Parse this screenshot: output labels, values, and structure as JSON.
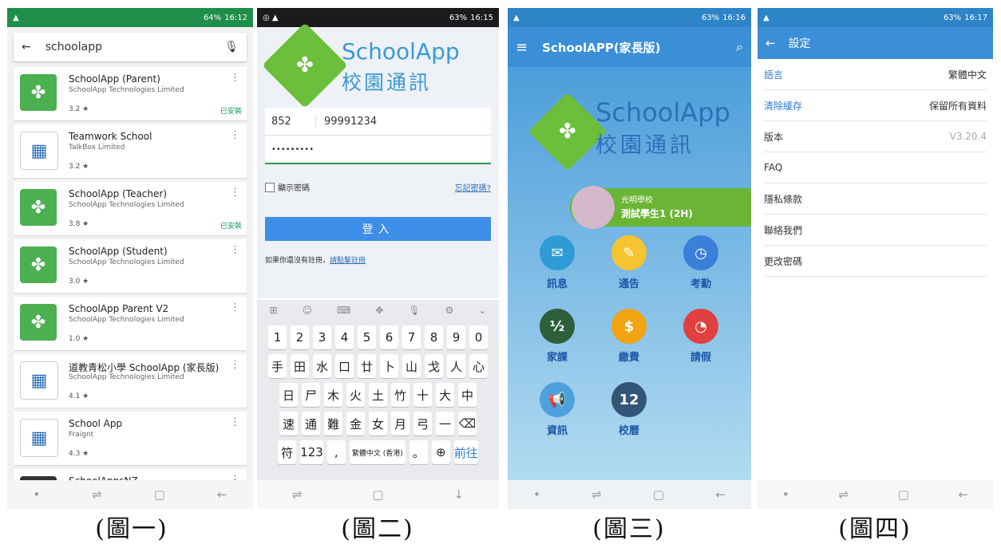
{
  "phone1": {
    "status_time": "16:12",
    "status_battery": "64%",
    "search_query": "schoolapp",
    "apps": [
      {
        "name": "SchoolApp (Parent)",
        "developer": "SchoolApp Technologies Limited",
        "rating": "3.2 ★",
        "installed": "已安裝",
        "icon_color": "#4caf50",
        "icon_label": "Parent"
      },
      {
        "name": "Teamwork School",
        "developer": "TalkBox Limited",
        "rating": "3.2 ★",
        "installed": "",
        "icon_color": "#ffffff",
        "icon_label": ""
      },
      {
        "name": "SchoolApp (Teacher)",
        "developer": "SchoolApp Technologies Limited",
        "rating": "3.8 ★",
        "installed": "已安裝",
        "icon_color": "#4caf50",
        "icon_label": "Teacher"
      },
      {
        "name": "SchoolApp (Student)",
        "developer": "SchoolApp Technologies Limited",
        "rating": "3.0 ★",
        "installed": "",
        "icon_color": "#4caf50",
        "icon_label": "Student"
      },
      {
        "name": "SchoolApp Parent V2",
        "developer": "SchoolApp Technologies Limited",
        "rating": "1.0 ★",
        "installed": "",
        "icon_color": "#4caf50",
        "icon_label": "Parent"
      },
      {
        "name": "道教青松小學 SchoolApp (家長版)",
        "developer": "SchoolApp Technologies Limited",
        "rating": "4.1 ★",
        "installed": "",
        "icon_color": "#ffffff",
        "icon_label": ""
      },
      {
        "name": "School App",
        "developer": "Fraignt",
        "rating": "4.3 ★",
        "installed": "",
        "icon_color": "#ffffff",
        "icon_label": ""
      },
      {
        "name": "SchoolAppsNZ",
        "developer": "",
        "rating": "",
        "installed": "",
        "icon_color": "#333333",
        "icon_label": ""
      }
    ],
    "caption": "(圖一)"
  },
  "phone2": {
    "status_time": "16:15",
    "status_battery": "63%",
    "logo_en": "SchoolApp",
    "logo_zh": "校園通訊",
    "country_code": "852",
    "phone_number": "99991234",
    "password": "•••••••••",
    "show_password": "顯示密碼",
    "forgot_password": "忘記密碼?",
    "login_button": "登入",
    "register_prompt": "如果你還沒有註冊，",
    "register_link": "請點擊註冊",
    "kb_row1": [
      "1",
      "2",
      "3",
      "4",
      "5",
      "6",
      "7",
      "8",
      "9",
      "0"
    ],
    "kb_row2": [
      "手",
      "田",
      "水",
      "口",
      "廿",
      "卜",
      "山",
      "戈",
      "人",
      "心"
    ],
    "kb_row3": [
      "日",
      "尸",
      "木",
      "火",
      "土",
      "竹",
      "十",
      "大",
      "中"
    ],
    "kb_row4": [
      "速",
      "通",
      "難",
      "金",
      "女",
      "月",
      "弓",
      "一",
      "⌫"
    ],
    "kb_row5": [
      "符",
      "123",
      ",",
      "繁體中文 (香港)",
      "。",
      "⊕",
      "前往"
    ],
    "caption": "(圖二)"
  },
  "phone3": {
    "status_time": "16:16",
    "status_battery": "63%",
    "app_title": "SchoolAPP(家長版)",
    "logo_en": "SchoolApp",
    "logo_zh": "校園通訊",
    "school_name": "光明學校",
    "student_name": "測試學生1 (2H)",
    "menu": [
      {
        "label": "訊息",
        "icon": "chat-icon",
        "color": "#2e9bd6",
        "glyph": "✉"
      },
      {
        "label": "通告",
        "icon": "notice-icon",
        "color": "#f5c431",
        "glyph": "✎"
      },
      {
        "label": "考勤",
        "icon": "clock-icon",
        "color": "#3a7fd8",
        "glyph": "◷"
      },
      {
        "label": "家課",
        "icon": "homework-icon",
        "color": "#2d5f3a",
        "glyph": "½"
      },
      {
        "label": "繳費",
        "icon": "payment-icon",
        "color": "#f2a312",
        "glyph": "$"
      },
      {
        "label": "請假",
        "icon": "leave-icon",
        "color": "#e04040",
        "glyph": "◔"
      },
      {
        "label": "資訊",
        "icon": "megaphone-icon",
        "color": "#4ea0dd",
        "glyph": "📢"
      },
      {
        "label": "校曆",
        "icon": "calendar-icon",
        "color": "#335577",
        "glyph": "12"
      }
    ],
    "caption": "(圖三)"
  },
  "phone4": {
    "status_time": "16:17",
    "status_battery": "63%",
    "title": "設定",
    "rows": [
      {
        "label": "語言",
        "value": "繁體中文",
        "blue": true,
        "grey": false
      },
      {
        "label": "清除緩存",
        "value": "保留所有資料",
        "blue": true,
        "grey": false
      },
      {
        "label": "版本",
        "value": "V3.20.4",
        "blue": false,
        "grey": true
      },
      {
        "label": "FAQ",
        "value": "",
        "blue": false,
        "grey": false
      },
      {
        "label": "隱私條款",
        "value": "",
        "blue": false,
        "grey": false
      },
      {
        "label": "聯絡我們",
        "value": "",
        "blue": false,
        "grey": false
      },
      {
        "label": "更改密碼",
        "value": "",
        "blue": false,
        "grey": false
      }
    ],
    "caption": "(圖四)"
  }
}
